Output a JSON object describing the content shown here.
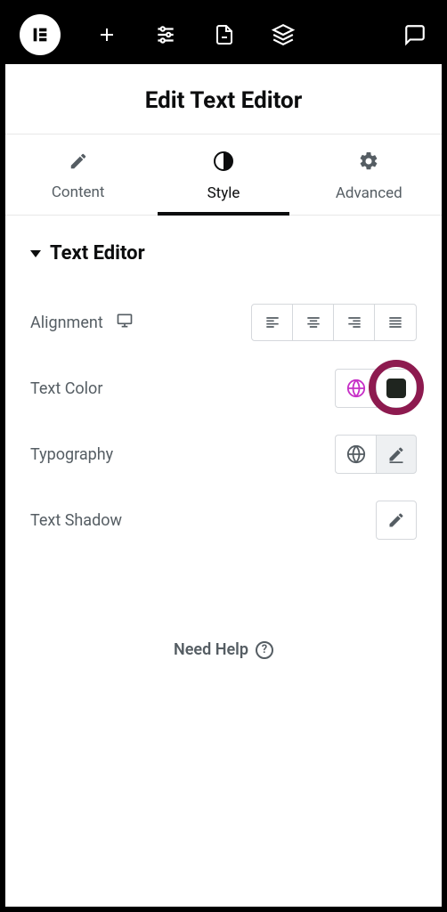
{
  "header": {
    "title": "Edit Text Editor"
  },
  "tabs": {
    "content": "Content",
    "style": "Style",
    "advanced": "Advanced",
    "active": "style"
  },
  "section": {
    "title": "Text Editor"
  },
  "controls": {
    "alignment": {
      "label": "Alignment"
    },
    "text_color": {
      "label": "Text Color",
      "swatch": "#1f251f"
    },
    "typography": {
      "label": "Typography"
    },
    "text_shadow": {
      "label": "Text Shadow"
    }
  },
  "help": {
    "label": "Need Help",
    "icon": "?"
  }
}
